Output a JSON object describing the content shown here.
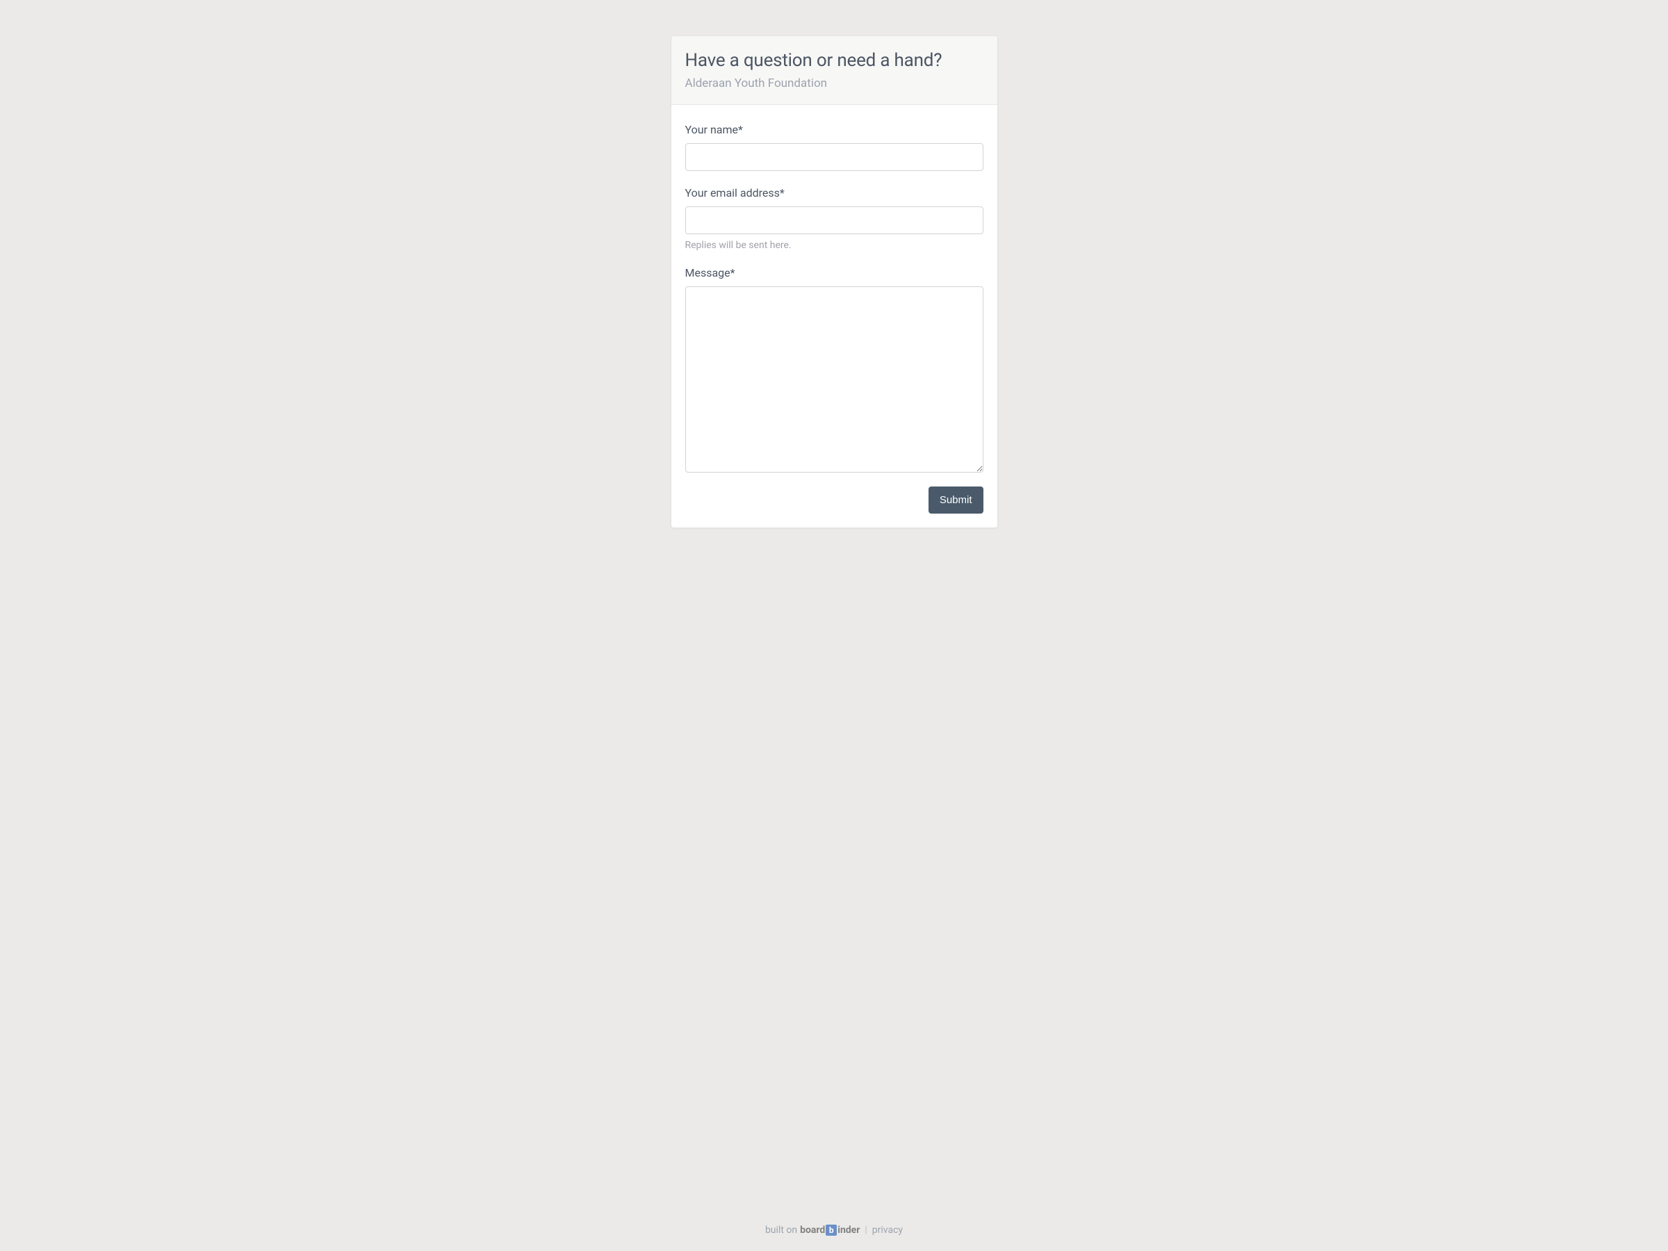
{
  "header": {
    "title": "Have a question or need a hand?",
    "subtitle": "Alderaan Youth Foundation"
  },
  "form": {
    "name_label": "Your name*",
    "email_label": "Your email address*",
    "email_hint": "Replies will be sent here.",
    "message_label": "Message*",
    "submit_label": "Submit"
  },
  "footer": {
    "built_on": "built on ",
    "brand_pre": "board",
    "brand_logo": "b",
    "brand_post": "inder",
    "separator": " | ",
    "privacy": "privacy"
  }
}
